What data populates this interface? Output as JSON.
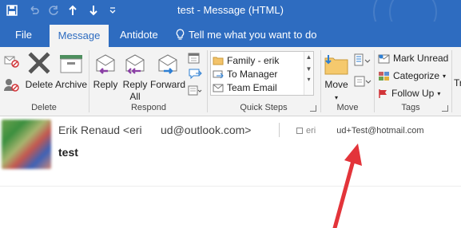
{
  "window": {
    "title": "test - Message (HTML)"
  },
  "tabs": [
    {
      "label": "File"
    },
    {
      "label": "Message"
    },
    {
      "label": "Antidote"
    },
    {
      "label": "Tell me what you want to do"
    }
  ],
  "ribbon": {
    "delete_group": {
      "label": "Delete",
      "delete": "Delete",
      "archive": "Archive"
    },
    "respond_group": {
      "label": "Respond",
      "reply": "Reply",
      "reply_all_1": "Reply",
      "reply_all_2": "All",
      "forward": "Forward"
    },
    "quick_steps": {
      "label": "Quick Steps",
      "items": [
        "Family - erik",
        "To Manager",
        "Team Email"
      ]
    },
    "move_group": {
      "label": "Move",
      "move": "Move"
    },
    "tags_group": {
      "label": "Tags",
      "mark_unread": "Mark Unread",
      "categorize": "Categorize",
      "follow_up": "Follow Up"
    },
    "overflow": "Tr"
  },
  "message": {
    "from_name": "Erik Renaud <eri",
    "from_hidden": "      ",
    "from_domain": "ud@outlook.com>",
    "to_prefix": "eri",
    "to_address": "ud+Test@hotmail.com",
    "subject": "test"
  },
  "colors": {
    "titlebar": "#2e6cc0",
    "ribbon": "#f3f3f3",
    "arrow": "#e3343a",
    "accent": "#2e6cc0"
  }
}
